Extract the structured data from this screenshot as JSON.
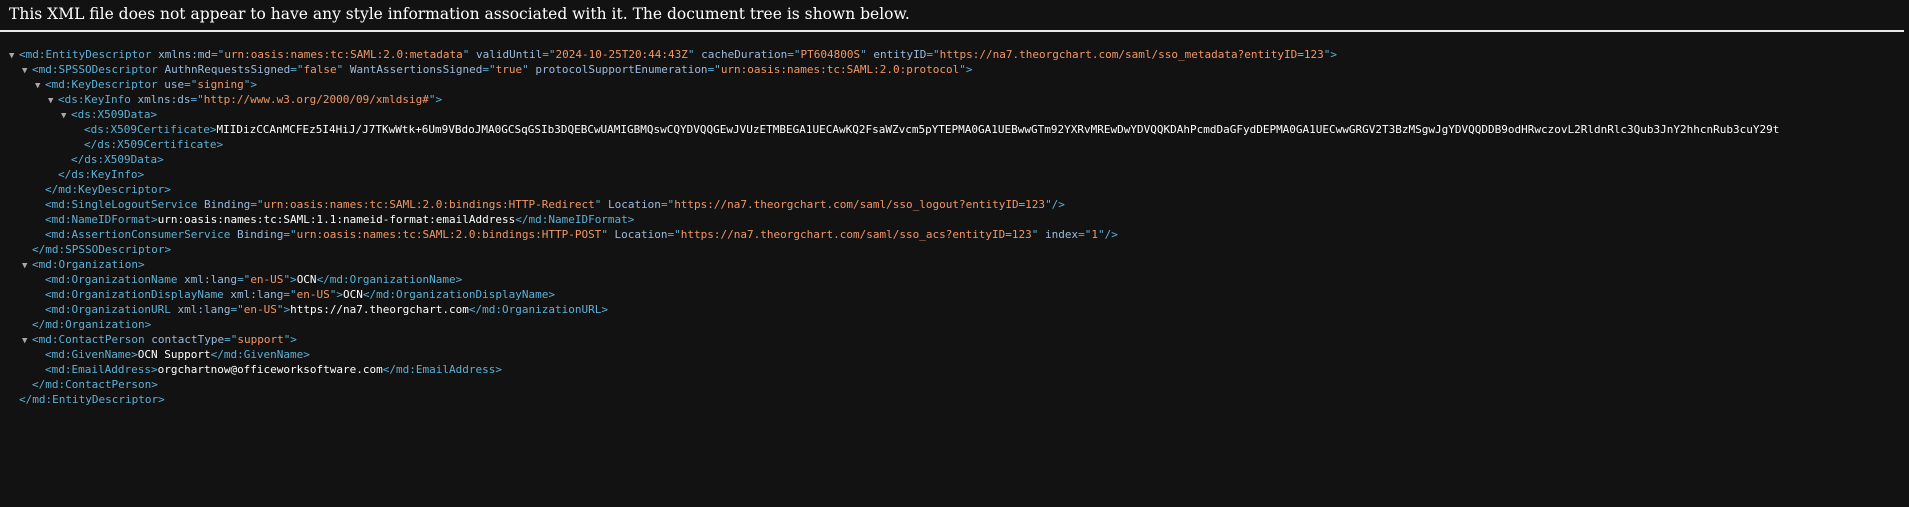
{
  "header": {
    "message": "This XML file does not appear to have any style information associated with it. The document tree is shown below."
  },
  "tree": [
    {
      "indent": 0,
      "toggle": true,
      "parts": [
        [
          "t",
          "<md:EntityDescriptor"
        ],
        [
          "a",
          " xmlns:md"
        ],
        [
          "t",
          "=\""
        ],
        [
          "v",
          "urn:oasis:names:tc:SAML:2.0:metadata"
        ],
        [
          "t",
          "\""
        ],
        [
          "a",
          " validUntil"
        ],
        [
          "t",
          "=\""
        ],
        [
          "v",
          "2024-10-25T20:44:43Z"
        ],
        [
          "t",
          "\""
        ],
        [
          "a",
          " cacheDuration"
        ],
        [
          "t",
          "=\""
        ],
        [
          "v",
          "PT604800S"
        ],
        [
          "t",
          "\""
        ],
        [
          "a",
          " entityID"
        ],
        [
          "t",
          "=\""
        ],
        [
          "v",
          "https://na7.theorgchart.com/saml/sso_metadata?entityID=123"
        ],
        [
          "t",
          "\">"
        ]
      ]
    },
    {
      "indent": 1,
      "toggle": true,
      "parts": [
        [
          "t",
          "<md:SPSSODescriptor"
        ],
        [
          "a",
          " AuthnRequestsSigned"
        ],
        [
          "t",
          "=\""
        ],
        [
          "v",
          "false"
        ],
        [
          "t",
          "\""
        ],
        [
          "a",
          " WantAssertionsSigned"
        ],
        [
          "t",
          "=\""
        ],
        [
          "v",
          "true"
        ],
        [
          "t",
          "\""
        ],
        [
          "a",
          " protocolSupportEnumeration"
        ],
        [
          "t",
          "=\""
        ],
        [
          "v",
          "urn:oasis:names:tc:SAML:2.0:protocol"
        ],
        [
          "t",
          "\">"
        ]
      ]
    },
    {
      "indent": 2,
      "toggle": true,
      "parts": [
        [
          "t",
          "<md:KeyDescriptor"
        ],
        [
          "a",
          " use"
        ],
        [
          "t",
          "=\""
        ],
        [
          "v",
          "signing"
        ],
        [
          "t",
          "\">"
        ]
      ]
    },
    {
      "indent": 3,
      "toggle": true,
      "parts": [
        [
          "t",
          "<ds:KeyInfo"
        ],
        [
          "a",
          " xmlns:ds"
        ],
        [
          "t",
          "=\""
        ],
        [
          "v",
          "http://www.w3.org/2000/09/xmldsig#"
        ],
        [
          "t",
          "\">"
        ]
      ]
    },
    {
      "indent": 4,
      "toggle": true,
      "parts": [
        [
          "t",
          "<ds:X509Data>"
        ]
      ]
    },
    {
      "indent": 5,
      "toggle": false,
      "parts": [
        [
          "t",
          "<ds:X509Certificate>"
        ],
        [
          "x",
          "MIIDizCCAnMCFEz5I4HiJ/J7TKwWtk+6Um9VBdoJMA0GCSqGSIb3DQEBCwUAMIGBMQswCQYDVQQGEwJVUzETMBEGA1UECAwKQ2FsaWZvcm5pYTEPMA0GA1UEBwwGTm92YXRvMREwDwYDVQQKDAhPcmdDaGFydDEPMA0GA1UECwwGRGV2T3BzMSgwJgYDVQQDDB9odHRwczovL2RldnRlc3Qub3JnY2hhcnRub3cuY29t"
        ]
      ]
    },
    {
      "indent": 5,
      "toggle": false,
      "parts": [
        [
          "t",
          "</ds:X509Certificate>"
        ]
      ]
    },
    {
      "indent": 4,
      "toggle": false,
      "parts": [
        [
          "t",
          "</ds:X509Data>"
        ]
      ]
    },
    {
      "indent": 3,
      "toggle": false,
      "parts": [
        [
          "t",
          "</ds:KeyInfo>"
        ]
      ]
    },
    {
      "indent": 2,
      "toggle": false,
      "parts": [
        [
          "t",
          "</md:KeyDescriptor>"
        ]
      ]
    },
    {
      "indent": 2,
      "toggle": false,
      "parts": [
        [
          "t",
          "<md:SingleLogoutService"
        ],
        [
          "a",
          " Binding"
        ],
        [
          "t",
          "=\""
        ],
        [
          "v",
          "urn:oasis:names:tc:SAML:2.0:bindings:HTTP-Redirect"
        ],
        [
          "t",
          "\""
        ],
        [
          "a",
          " Location"
        ],
        [
          "t",
          "=\""
        ],
        [
          "v",
          "https://na7.theorgchart.com/saml/sso_logout?entityID=123"
        ],
        [
          "t",
          "\"/>"
        ]
      ]
    },
    {
      "indent": 2,
      "toggle": false,
      "parts": [
        [
          "t",
          "<md:NameIDFormat>"
        ],
        [
          "x",
          "urn:oasis:names:tc:SAML:1.1:nameid-format:emailAddress"
        ],
        [
          "t",
          "</md:NameIDFormat>"
        ]
      ]
    },
    {
      "indent": 2,
      "toggle": false,
      "parts": [
        [
          "t",
          "<md:AssertionConsumerService"
        ],
        [
          "a",
          " Binding"
        ],
        [
          "t",
          "=\""
        ],
        [
          "v",
          "urn:oasis:names:tc:SAML:2.0:bindings:HTTP-POST"
        ],
        [
          "t",
          "\""
        ],
        [
          "a",
          " Location"
        ],
        [
          "t",
          "=\""
        ],
        [
          "v",
          "https://na7.theorgchart.com/saml/sso_acs?entityID=123"
        ],
        [
          "t",
          "\""
        ],
        [
          "a",
          " index"
        ],
        [
          "t",
          "=\""
        ],
        [
          "v",
          "1"
        ],
        [
          "t",
          "\"/>"
        ]
      ]
    },
    {
      "indent": 1,
      "toggle": false,
      "parts": [
        [
          "t",
          "</md:SPSSODescriptor>"
        ]
      ]
    },
    {
      "indent": 1,
      "toggle": true,
      "parts": [
        [
          "t",
          "<md:Organization>"
        ]
      ]
    },
    {
      "indent": 2,
      "toggle": false,
      "parts": [
        [
          "t",
          "<md:OrganizationName"
        ],
        [
          "a",
          " xml:lang"
        ],
        [
          "t",
          "=\""
        ],
        [
          "v",
          "en-US"
        ],
        [
          "t",
          "\">"
        ],
        [
          "x",
          "OCN"
        ],
        [
          "t",
          "</md:OrganizationName>"
        ]
      ]
    },
    {
      "indent": 2,
      "toggle": false,
      "parts": [
        [
          "t",
          "<md:OrganizationDisplayName"
        ],
        [
          "a",
          " xml:lang"
        ],
        [
          "t",
          "=\""
        ],
        [
          "v",
          "en-US"
        ],
        [
          "t",
          "\">"
        ],
        [
          "x",
          "OCN"
        ],
        [
          "t",
          "</md:OrganizationDisplayName>"
        ]
      ]
    },
    {
      "indent": 2,
      "toggle": false,
      "parts": [
        [
          "t",
          "<md:OrganizationURL"
        ],
        [
          "a",
          " xml:lang"
        ],
        [
          "t",
          "=\""
        ],
        [
          "v",
          "en-US"
        ],
        [
          "t",
          "\">"
        ],
        [
          "x",
          "https://na7.theorgchart.com"
        ],
        [
          "t",
          "</md:OrganizationURL>"
        ]
      ]
    },
    {
      "indent": 1,
      "toggle": false,
      "parts": [
        [
          "t",
          "</md:Organization>"
        ]
      ]
    },
    {
      "indent": 1,
      "toggle": true,
      "parts": [
        [
          "t",
          "<md:ContactPerson"
        ],
        [
          "a",
          " contactType"
        ],
        [
          "t",
          "=\""
        ],
        [
          "v",
          "support"
        ],
        [
          "t",
          "\">"
        ]
      ]
    },
    {
      "indent": 2,
      "toggle": false,
      "parts": [
        [
          "t",
          "<md:GivenName>"
        ],
        [
          "x",
          "OCN Support"
        ],
        [
          "t",
          "</md:GivenName>"
        ]
      ]
    },
    {
      "indent": 2,
      "toggle": false,
      "parts": [
        [
          "t",
          "<md:EmailAddress>"
        ],
        [
          "x",
          "orgchartnow@officeworksoftware.com"
        ],
        [
          "t",
          "</md:EmailAddress>"
        ]
      ]
    },
    {
      "indent": 1,
      "toggle": false,
      "parts": [
        [
          "t",
          "</md:ContactPerson>"
        ]
      ]
    },
    {
      "indent": 0,
      "toggle": false,
      "parts": [
        [
          "t",
          "</md:EntityDescriptor>"
        ]
      ]
    }
  ]
}
